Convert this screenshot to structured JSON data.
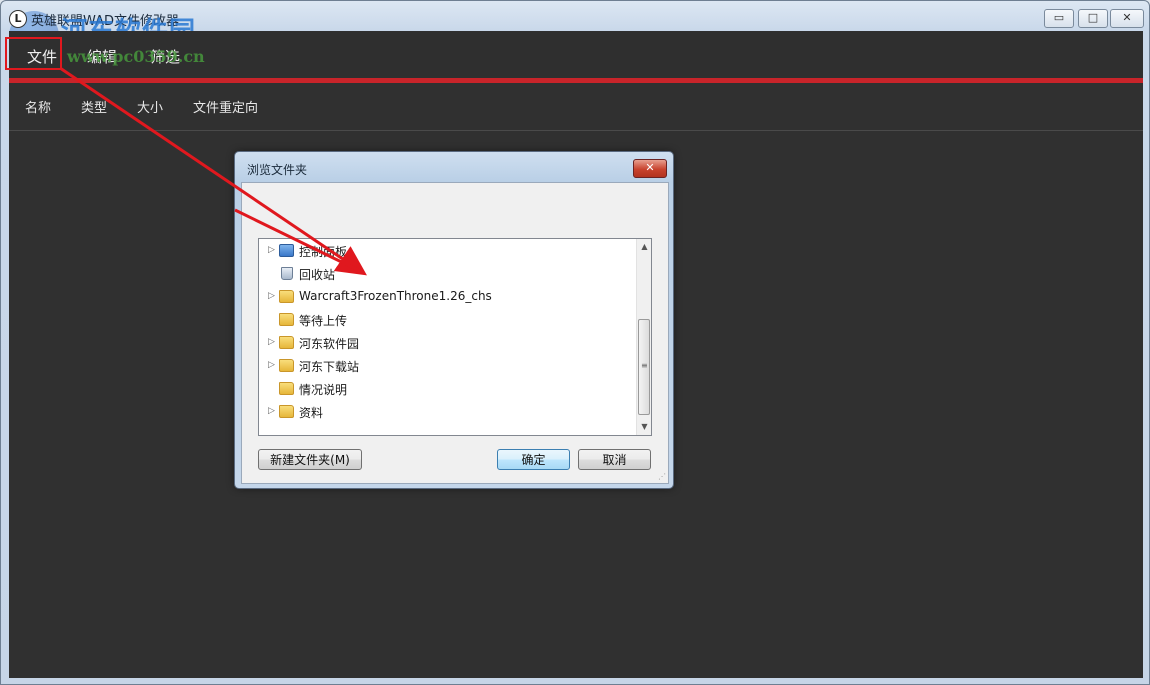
{
  "window": {
    "title": "英雄联盟WAD文件修改器",
    "min_glyph": "▭",
    "max_glyph": "□",
    "close_glyph": "✕"
  },
  "watermark": {
    "text": "河东软件园",
    "url": "www.pc0359.cn"
  },
  "menu": {
    "items": [
      "文件",
      "编辑",
      "筛选"
    ]
  },
  "columns": [
    "名称",
    "类型",
    "大小",
    "文件重定向"
  ],
  "colors": {
    "accent_red": "#c8242a",
    "client_bg": "#303030"
  },
  "dialog": {
    "title": "浏览文件夹",
    "close_glyph": "✕",
    "tree": [
      {
        "label": "控制面板",
        "icon": "control-panel-icon",
        "expandable": true
      },
      {
        "label": "回收站",
        "icon": "recycle-bin-icon",
        "expandable": false
      },
      {
        "label": "Warcraft3FrozenThrone1.26_chs",
        "icon": "folder-icon",
        "expandable": true
      },
      {
        "label": "等待上传",
        "icon": "folder-icon",
        "expandable": false
      },
      {
        "label": "河东软件园",
        "icon": "folder-icon",
        "expandable": true
      },
      {
        "label": "河东下载站",
        "icon": "folder-icon",
        "expandable": true
      },
      {
        "label": "情况说明",
        "icon": "folder-icon",
        "expandable": false
      },
      {
        "label": "资料",
        "icon": "folder-icon",
        "expandable": true
      }
    ],
    "new_folder_label": "新建文件夹(M)",
    "ok_label": "确定",
    "cancel_label": "取消"
  }
}
